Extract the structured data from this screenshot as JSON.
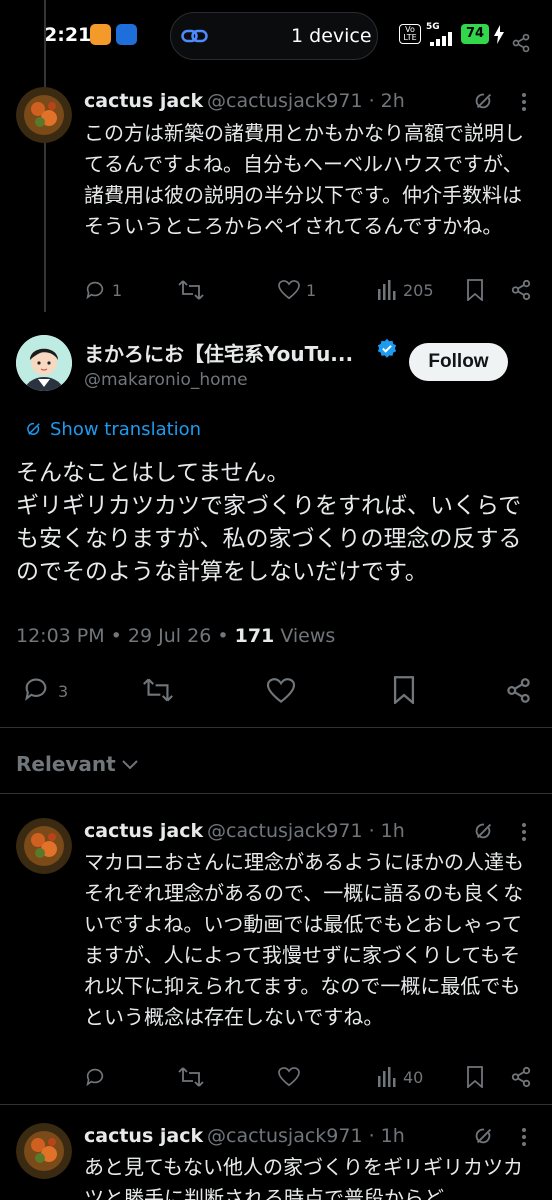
{
  "status_bar": {
    "time": "2:21",
    "pill_text": "1 device",
    "network": "5G",
    "battery": "74"
  },
  "reply1": {
    "name": "cactus jack",
    "handle": "@cactusjack971 · 2h",
    "text": "この方は新築の諸費用とかもかなり高額で説明してるんですよね。自分もヘーベルハウスですが、諸費用は彼の説明の半分以下です。仲介手数料はそういうところからペイされてるんですかね。",
    "replies": "1",
    "likes": "1",
    "views": "205"
  },
  "main_tweet": {
    "name": "まかろにお【住宅系YouTu...",
    "handle": "@makaronio_home",
    "follow_label": "Follow",
    "show_translation": "Show translation",
    "text": "そんなことはしてません。\nギリギリカツカツで家づくりをすれば、いくらでも安くなりますが、私の家づくりの理念の反するのでそのような計算をしないだけです。",
    "timestamp": "12:03 PM • 29 Jul 26 •",
    "views_count": "171",
    "views_label": "Views",
    "replies": "3"
  },
  "sort": {
    "label": "Relevant"
  },
  "reply2": {
    "name": "cactus jack",
    "handle": "@cactusjack971 · 1h",
    "text": "マカロニおさんに理念があるようにほかの人達もそれぞれ理念があるので、一概に語るのも良くないですよね。いつ動画では最低でもとおしゃってますが、人によって我慢せずに家づくりしてもそれ以下に抑えられてます。なので一概に最低でもという概念は存在しないですね。",
    "views": "40"
  },
  "reply3": {
    "name": "cactus jack",
    "handle": "@cactusjack971 · 1h",
    "text": "あと見てもない他人の家づくりをギリギリカツカツと勝手に判断される時点で普段からど"
  },
  "colors": {
    "background": "#000000",
    "text": "#e7e9ea",
    "muted": "#71767b",
    "accent": "#1d9bf0",
    "battery": "#32d74b"
  }
}
